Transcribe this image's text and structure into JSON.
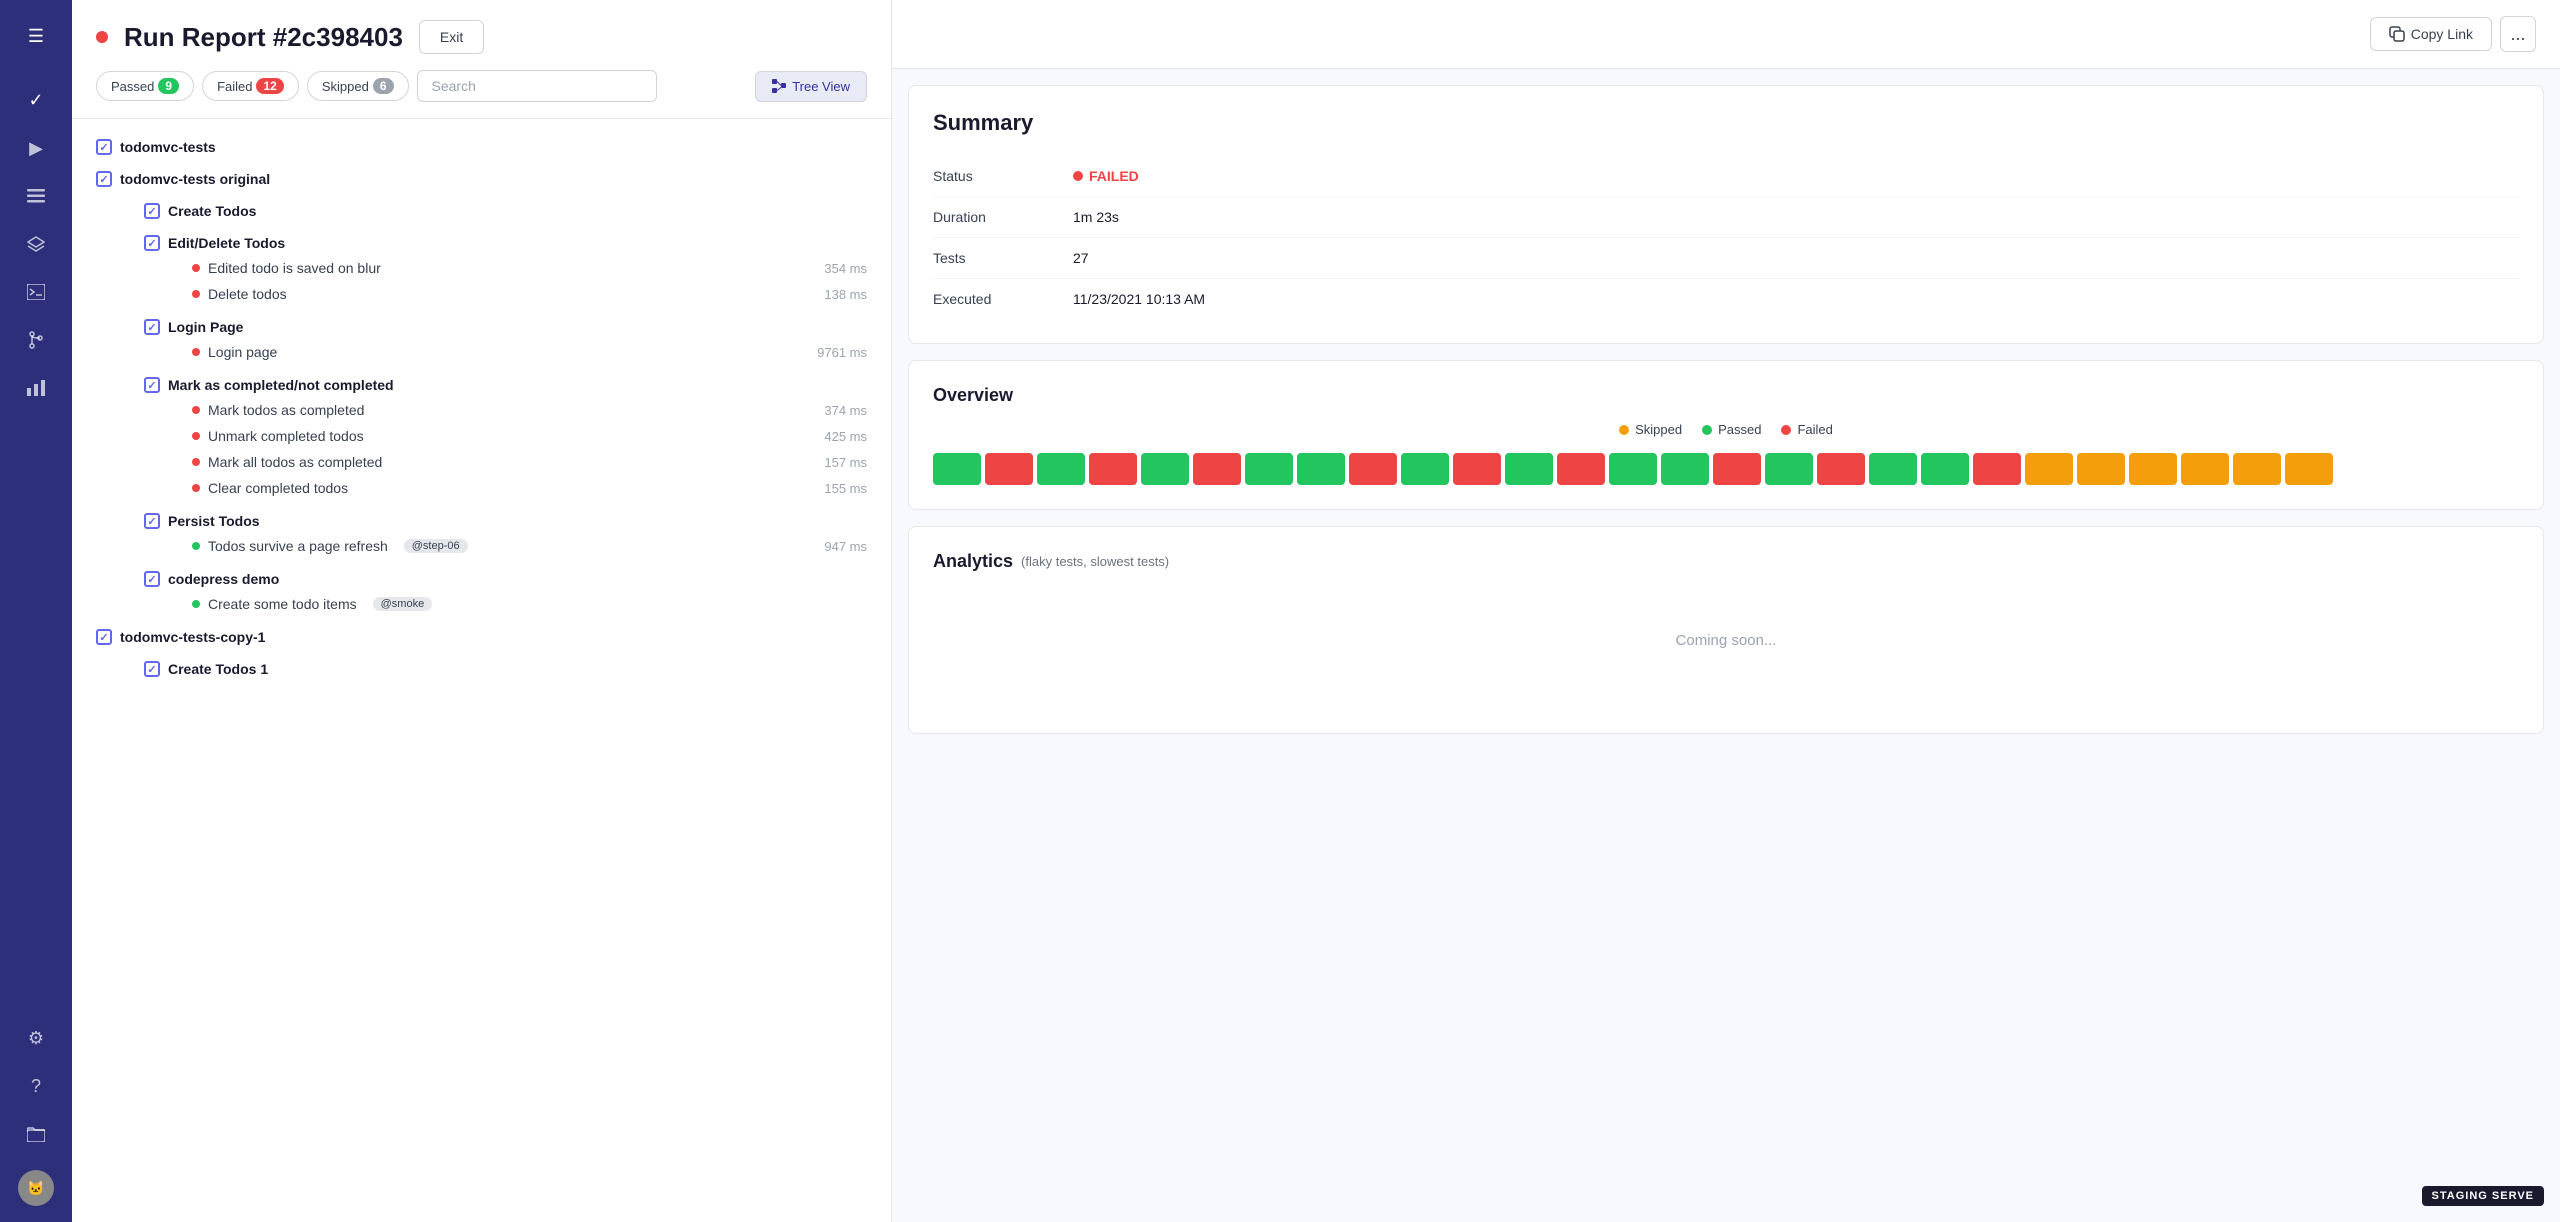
{
  "sidebar": {
    "icons": [
      {
        "name": "menu-icon",
        "symbol": "☰"
      },
      {
        "name": "check-icon",
        "symbol": "✓"
      },
      {
        "name": "play-icon",
        "symbol": "▶"
      },
      {
        "name": "list-icon",
        "symbol": "≡"
      },
      {
        "name": "layers-icon",
        "symbol": "⬡"
      },
      {
        "name": "terminal-icon",
        "symbol": "⊳"
      },
      {
        "name": "branch-icon",
        "symbol": "⌥"
      },
      {
        "name": "chart-icon",
        "symbol": "▦"
      },
      {
        "name": "settings-icon",
        "symbol": "⚙"
      },
      {
        "name": "help-icon",
        "symbol": "?"
      },
      {
        "name": "folder-icon",
        "symbol": "⊞"
      }
    ]
  },
  "header": {
    "run_number": "Run Report #2c398403",
    "exit_label": "Exit",
    "filters": {
      "passed_label": "Passed",
      "passed_count": "9",
      "failed_label": "Failed",
      "failed_count": "12",
      "skipped_label": "Skipped",
      "skipped_count": "6"
    },
    "search_placeholder": "Search",
    "tree_view_label": "Tree View"
  },
  "test_tree": {
    "root_suite": "todomvc-tests",
    "suites": [
      {
        "name": "todomvc-tests original",
        "children": [
          {
            "type": "suite",
            "name": "Create Todos",
            "children": []
          },
          {
            "type": "suite",
            "name": "Edit/Delete Todos",
            "children": [
              {
                "type": "test",
                "name": "Edited todo is saved on blur",
                "status": "failed",
                "duration": "354 ms"
              },
              {
                "type": "test",
                "name": "Delete todos",
                "status": "failed",
                "duration": "138 ms"
              }
            ]
          },
          {
            "type": "suite",
            "name": "Login Page",
            "children": [
              {
                "type": "test",
                "name": "Login page",
                "status": "failed",
                "duration": "9761 ms"
              }
            ]
          },
          {
            "type": "suite",
            "name": "Mark as completed/not completed",
            "children": [
              {
                "type": "test",
                "name": "Mark todos as completed",
                "status": "failed",
                "duration": "374 ms"
              },
              {
                "type": "test",
                "name": "Unmark completed todos",
                "status": "failed",
                "duration": "425 ms"
              },
              {
                "type": "test",
                "name": "Mark all todos as completed",
                "status": "failed",
                "duration": "157 ms"
              },
              {
                "type": "test",
                "name": "Clear completed todos",
                "status": "failed",
                "duration": "155 ms"
              }
            ]
          },
          {
            "type": "suite",
            "name": "Persist Todos",
            "children": [
              {
                "type": "test",
                "name": "Todos survive a page refresh",
                "status": "passed",
                "duration": "947 ms",
                "tag": "@step-06"
              }
            ]
          },
          {
            "type": "suite",
            "name": "codepress demo",
            "children": [
              {
                "type": "test",
                "name": "Create some todo items",
                "status": "passed",
                "duration": null,
                "tag": "@smoke"
              }
            ]
          }
        ]
      },
      {
        "name": "todomvc-tests-copy-1",
        "children": [
          {
            "type": "suite",
            "name": "Create Todos 1",
            "children": []
          }
        ]
      }
    ]
  },
  "right_panel": {
    "copy_link_label": "Copy Link",
    "more_label": "...",
    "summary": {
      "title": "Summary",
      "rows": [
        {
          "label": "Status",
          "value": "FAILED",
          "type": "status"
        },
        {
          "label": "Duration",
          "value": "1m 23s"
        },
        {
          "label": "Tests",
          "value": "27"
        },
        {
          "label": "Executed",
          "value": "11/23/2021 10:13 AM"
        }
      ]
    },
    "overview": {
      "title": "Overview",
      "legend": [
        {
          "label": "Skipped",
          "type": "skipped"
        },
        {
          "label": "Passed",
          "type": "passed"
        },
        {
          "label": "Failed",
          "type": "failed"
        }
      ],
      "cells": [
        "passed",
        "failed",
        "passed",
        "failed",
        "passed",
        "failed",
        "passed",
        "passed",
        "failed",
        "passed",
        "failed",
        "passed",
        "failed",
        "passed",
        "passed",
        "failed",
        "passed",
        "failed",
        "passed",
        "passed",
        "failed",
        "skipped",
        "skipped",
        "skipped",
        "skipped",
        "skipped",
        "skipped"
      ]
    },
    "analytics": {
      "title": "Analytics",
      "subtitle": "(flaky tests, slowest tests)",
      "coming_soon": "Coming soon..."
    }
  },
  "staging_badge": "STAGING SERVE"
}
